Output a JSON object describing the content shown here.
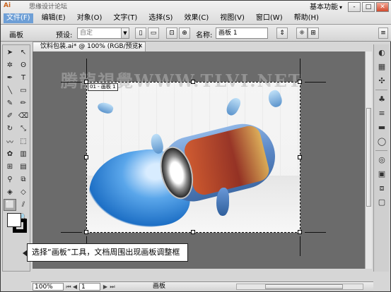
{
  "app": {
    "logo_text": "Ai",
    "site_text": "思缘设计论坛",
    "workspace": "基本功能"
  },
  "menu": [
    "文件(F)",
    "编辑(E)",
    "对象(O)",
    "文字(T)",
    "选择(S)",
    "效果(C)",
    "视图(V)",
    "窗口(W)",
    "帮助(H)"
  ],
  "window_buttons": [
    "-",
    "□",
    "✕"
  ],
  "control_bar": {
    "tool_label": "画板",
    "preset_label": "预设:",
    "preset_value": "自定",
    "name_label": "名称:",
    "name_value": "画板 1"
  },
  "document": {
    "tab_title": "饮料包装.ai* @ 100% (RGB/预览)",
    "tab_close": "✕",
    "artboard_label": "01 - 画板 1",
    "watermark": "腾龍視覺WWW.TLVI.NET"
  },
  "callout": {
    "text": "选择“画板”工具，文档周围出现画板调整框"
  },
  "status_bar": {
    "zoom": "100%",
    "page": "1",
    "tool_name": "画板"
  },
  "tools": [
    {
      "icon": "selection-icon",
      "glyph": "➤"
    },
    {
      "icon": "direct-selection-icon",
      "glyph": "↖"
    },
    {
      "icon": "magic-wand-icon",
      "glyph": "✲"
    },
    {
      "icon": "lasso-icon",
      "glyph": "ʘ"
    },
    {
      "icon": "pen-icon",
      "glyph": "✒"
    },
    {
      "icon": "type-icon",
      "glyph": "T"
    },
    {
      "icon": "line-icon",
      "glyph": "╲"
    },
    {
      "icon": "rectangle-icon",
      "glyph": "▭"
    },
    {
      "icon": "paintbrush-icon",
      "glyph": "✎"
    },
    {
      "icon": "pencil-icon",
      "glyph": "✏"
    },
    {
      "icon": "blob-brush-icon",
      "glyph": "✐"
    },
    {
      "icon": "eraser-icon",
      "glyph": "⌫"
    },
    {
      "icon": "rotate-icon",
      "glyph": "↻"
    },
    {
      "icon": "scale-icon",
      "glyph": "⤡"
    },
    {
      "icon": "warp-icon",
      "glyph": "〰"
    },
    {
      "icon": "free-transform-icon",
      "glyph": "⬚"
    },
    {
      "icon": "symbol-sprayer-icon",
      "glyph": "✿"
    },
    {
      "icon": "column-graph-icon",
      "glyph": "▥"
    },
    {
      "icon": "mesh-icon",
      "glyph": "⊞"
    },
    {
      "icon": "gradient-icon",
      "glyph": "▤"
    },
    {
      "icon": "eyedropper-icon",
      "glyph": "⚲"
    },
    {
      "icon": "blend-icon",
      "glyph": "⧉"
    },
    {
      "icon": "live-paint-icon",
      "glyph": "◈"
    },
    {
      "icon": "live-paint-select-icon",
      "glyph": "◇"
    },
    {
      "icon": "artboard-icon",
      "glyph": "⬜"
    },
    {
      "icon": "slice-icon",
      "glyph": "⫽"
    },
    {
      "icon": "hand-icon",
      "glyph": "✋"
    },
    {
      "icon": "zoom-icon",
      "glyph": "🔍"
    }
  ],
  "dock": [
    {
      "icon": "color-panel-icon",
      "glyph": "◐"
    },
    {
      "icon": "swatches-panel-icon",
      "glyph": "▦"
    },
    {
      "icon": "brushes-panel-icon",
      "glyph": "✣"
    },
    {
      "icon": "symbols-panel-icon",
      "glyph": "♣"
    },
    {
      "icon": "stroke-panel-icon",
      "glyph": "≡"
    },
    {
      "icon": "gradient-panel-icon",
      "glyph": "▬"
    },
    {
      "icon": "transparency-panel-icon",
      "glyph": "◯"
    },
    {
      "icon": "appearance-panel-icon",
      "glyph": "◎"
    },
    {
      "icon": "graphic-styles-panel-icon",
      "glyph": "▣"
    },
    {
      "icon": "layers-panel-icon",
      "glyph": "⧈"
    },
    {
      "icon": "artboards-panel-icon",
      "glyph": "▢"
    }
  ]
}
